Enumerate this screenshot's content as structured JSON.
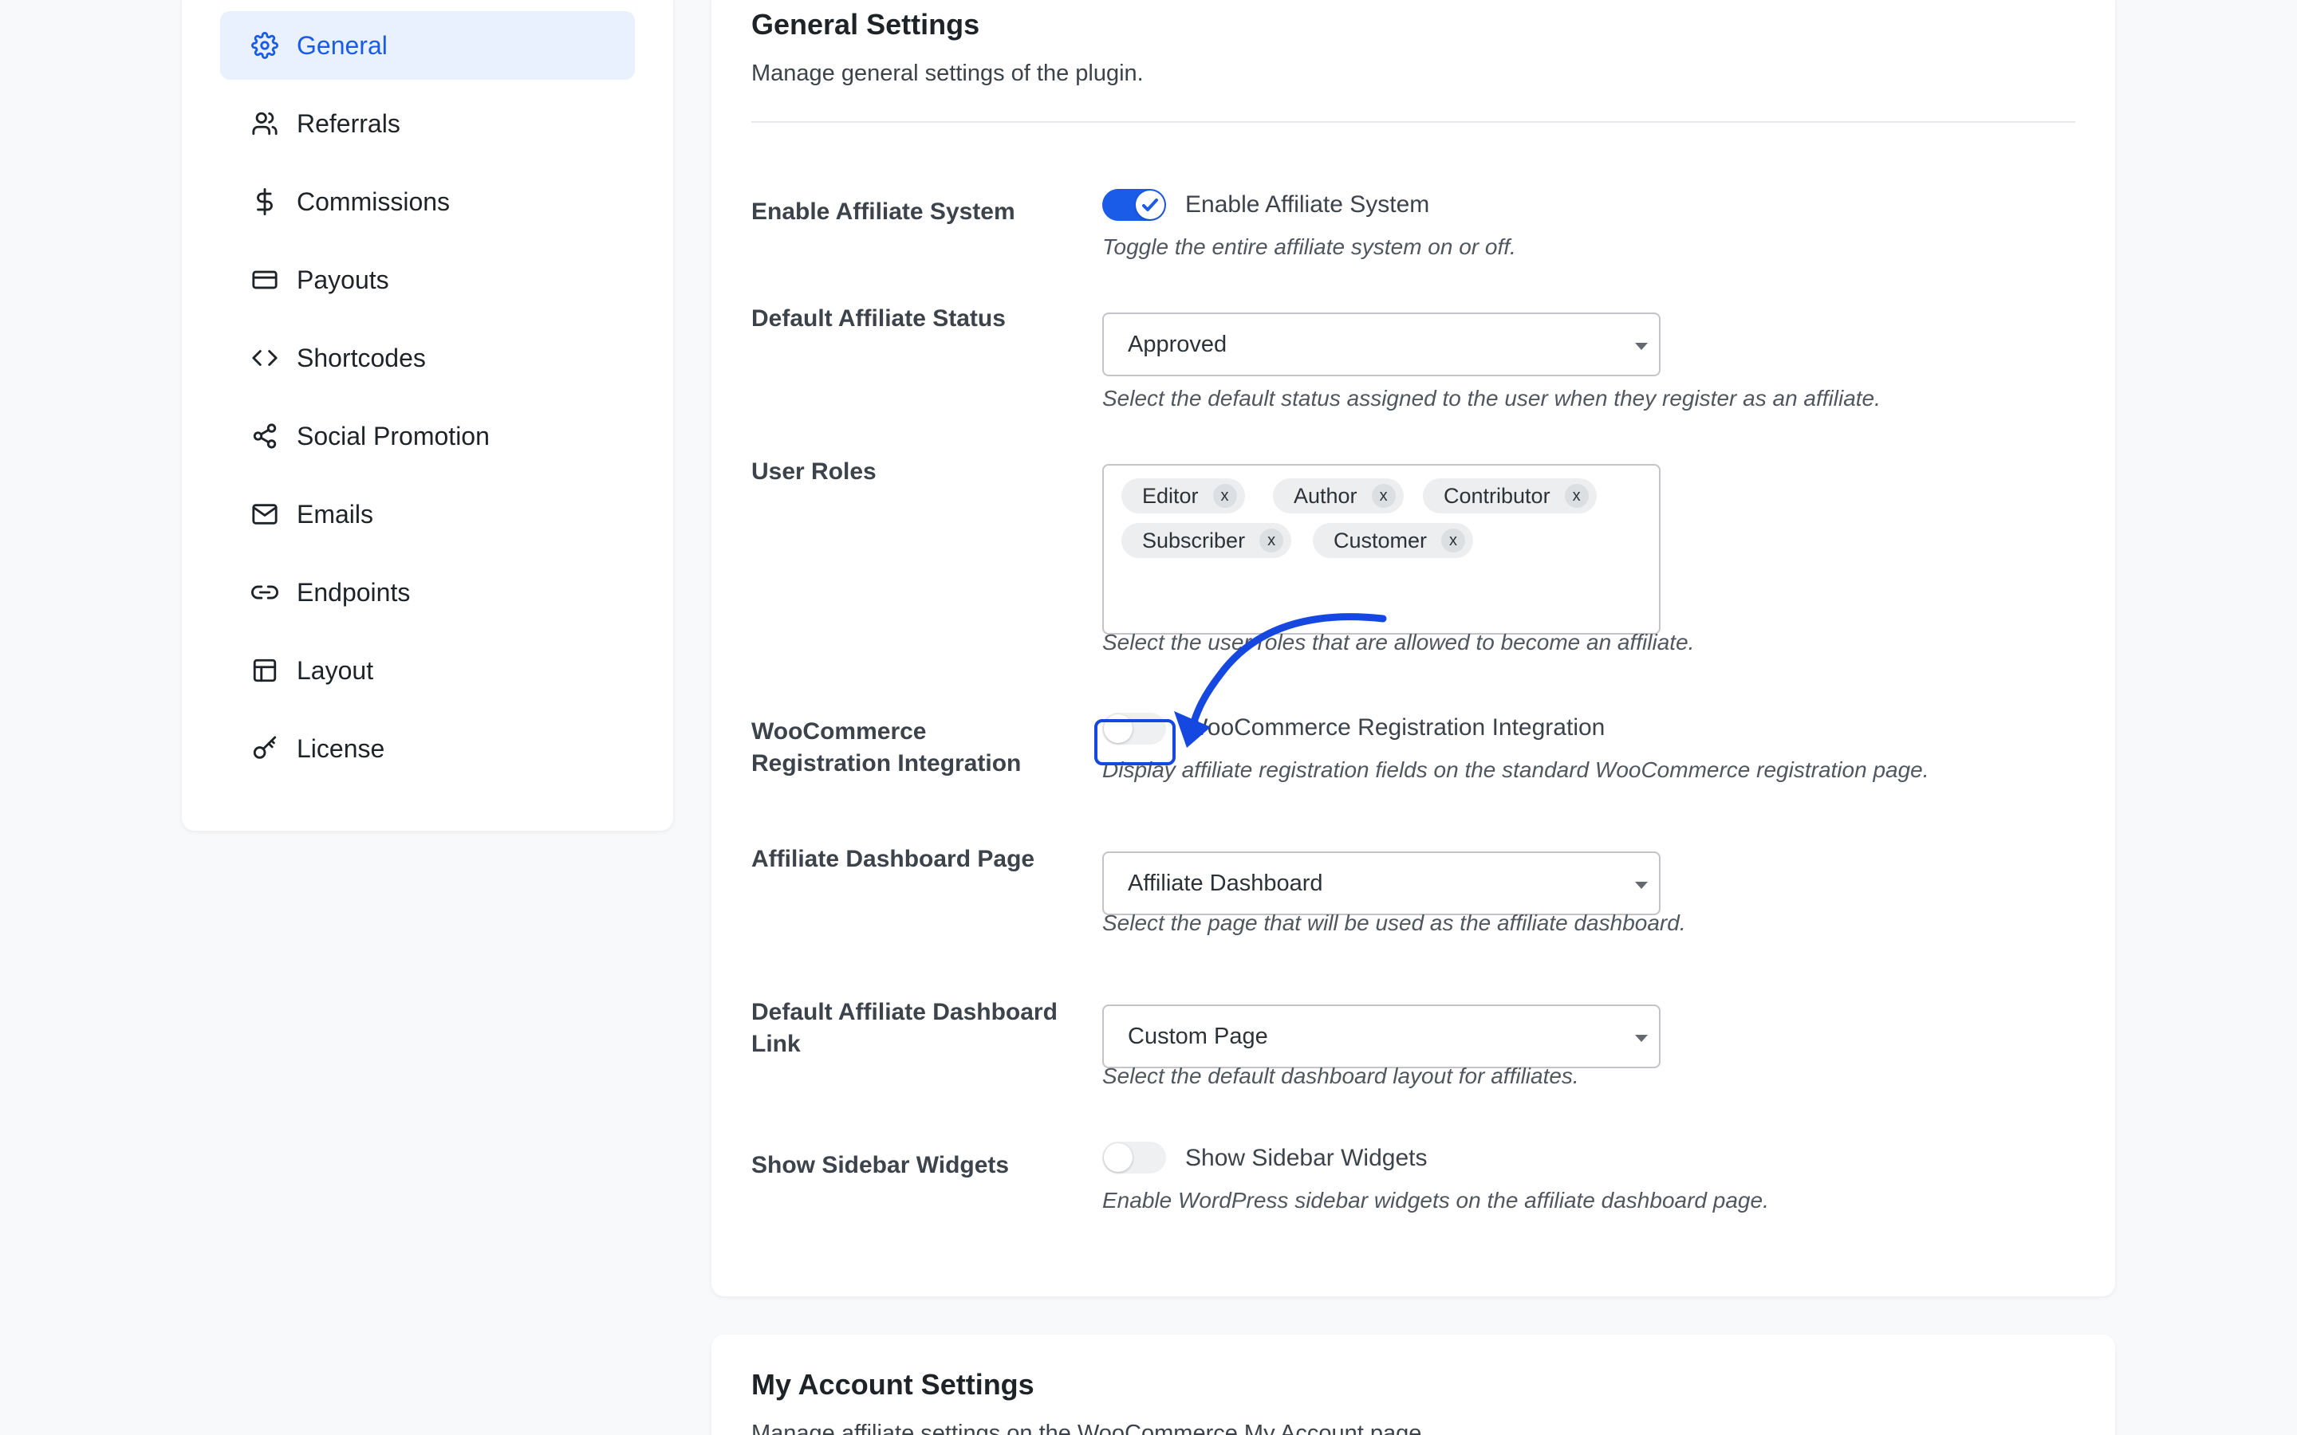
{
  "sidebar": {
    "items": [
      {
        "label": "General",
        "icon": "gear-icon",
        "active": true
      },
      {
        "label": "Referrals",
        "icon": "users-icon"
      },
      {
        "label": "Commissions",
        "icon": "dollar-icon"
      },
      {
        "label": "Payouts",
        "icon": "credit-card-icon"
      },
      {
        "label": "Shortcodes",
        "icon": "code-icon"
      },
      {
        "label": "Social Promotion",
        "icon": "share-icon"
      },
      {
        "label": "Emails",
        "icon": "mail-icon"
      },
      {
        "label": "Endpoints",
        "icon": "link-icon"
      },
      {
        "label": "Layout",
        "icon": "layout-icon"
      },
      {
        "label": "License",
        "icon": "key-icon"
      }
    ]
  },
  "general": {
    "title": "General Settings",
    "description": "Manage general settings of the plugin.",
    "enable_affiliate": {
      "label": "Enable Affiliate System",
      "toggle_text": "Enable Affiliate System",
      "help": "Toggle the entire affiliate system on or off.",
      "enabled": true
    },
    "default_status": {
      "label": "Default Affiliate Status",
      "value": "Approved",
      "help": "Select the default status assigned to the user when they register as an affiliate."
    },
    "user_roles": {
      "label": "User Roles",
      "tags": [
        "Editor",
        "Author",
        "Contributor",
        "Subscriber",
        "Customer"
      ],
      "remove_glyph": "x",
      "help": "Select the user roles that are allowed to become an affiliate."
    },
    "woo_integration": {
      "label_line1": "WooCommerce",
      "label_line2": "Registration Integration",
      "toggle_text": "WooCommerce Registration Integration",
      "help": "Display affiliate registration fields on the standard WooCommerce registration page.",
      "enabled": false
    },
    "dashboard_page": {
      "label": "Affiliate Dashboard Page",
      "value": "Affiliate Dashboard",
      "help": "Select the page that will be used as the affiliate dashboard."
    },
    "dashboard_link": {
      "label_line1": "Default Affiliate Dashboard",
      "label_line2": "Link",
      "value": "Custom Page",
      "help": "Select the default dashboard layout for affiliates."
    },
    "sidebar_widgets": {
      "label": "Show Sidebar Widgets",
      "toggle_text": "Show Sidebar Widgets",
      "help": "Enable WordPress sidebar widgets on the affiliate dashboard page.",
      "enabled": false
    }
  },
  "my_account": {
    "title": "My Account Settings",
    "description": "Manage affiliate settings on the WooCommerce My Account page."
  },
  "colors": {
    "accent": "#1a5ce8",
    "annotation": "#1448e0"
  }
}
